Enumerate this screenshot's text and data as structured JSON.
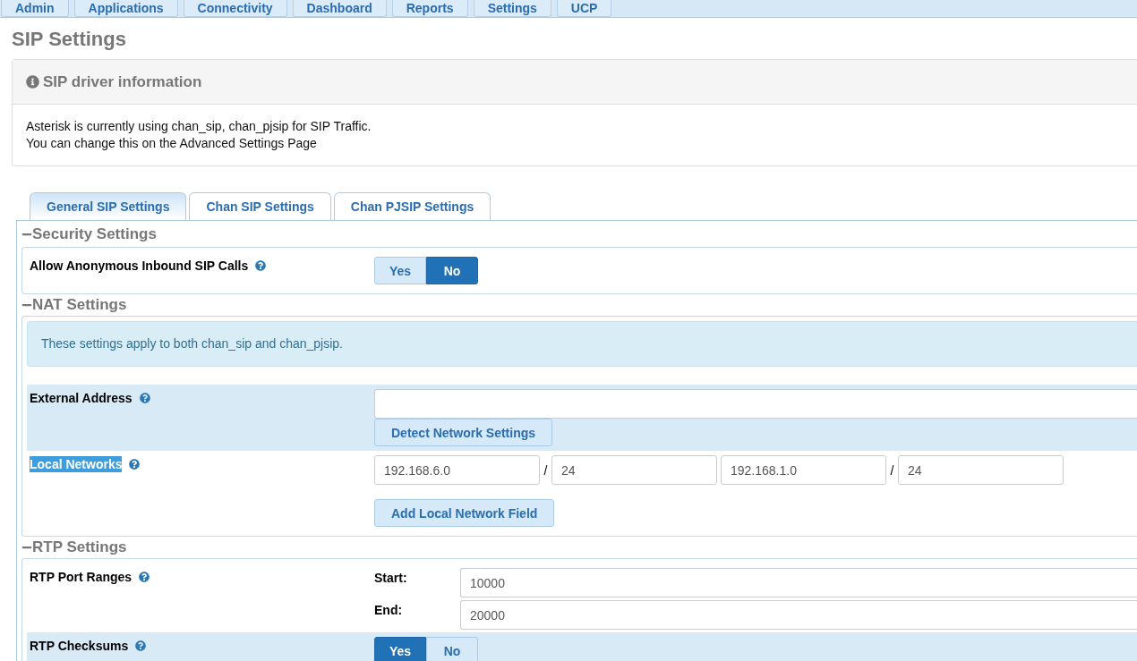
{
  "nav": [
    "Admin",
    "Applications",
    "Connectivity",
    "Dashboard",
    "Reports",
    "Settings",
    "UCP"
  ],
  "page_title": "SIP Settings",
  "info_panel": {
    "title": "SIP driver information",
    "lines": [
      "Asterisk is currently using chan_sip, chan_pjsip for SIP Traffic.",
      "You can change this on the Advanced Settings Page"
    ]
  },
  "tabs": [
    {
      "label": "General SIP Settings",
      "selected": true
    },
    {
      "label": "Chan SIP Settings",
      "selected": false
    },
    {
      "label": "Chan PJSIP Settings",
      "selected": false
    }
  ],
  "sections": [
    {
      "title": "Security Settings",
      "rows": [
        {
          "kind": "toggle",
          "label": "Allow Anonymous Inbound SIP Calls",
          "shaded": false,
          "label_selected": false,
          "options": [
            {
              "label": "Yes",
              "selected": false
            },
            {
              "label": "No",
              "selected": true
            }
          ]
        }
      ]
    },
    {
      "title": "NAT Settings",
      "notice": "These settings apply to both chan_sip and chan_pjsip.",
      "rows": [
        {
          "kind": "address",
          "label": "External Address",
          "shaded": true,
          "label_selected": false,
          "button": "Detect Network Settings"
        },
        {
          "kind": "networks",
          "label": "Local Networks",
          "shaded": false,
          "label_selected": true,
          "networks": [
            {
              "address": "192.168.6.0",
              "separator": "/",
              "mask": "24"
            },
            {
              "address": "192.168.1.0",
              "separator": "/",
              "mask": "24"
            }
          ],
          "button": "Add Local Network Field"
        }
      ]
    },
    {
      "title": "RTP Settings",
      "rows": [
        {
          "kind": "range",
          "label": "RTP Port Ranges",
          "shaded": false,
          "label_selected": false,
          "fields": [
            {
              "label": "Start:",
              "value": "10000"
            },
            {
              "label": "End:",
              "value": "20000"
            }
          ]
        },
        {
          "kind": "toggle",
          "label": "RTP Checksums",
          "shaded": true,
          "label_selected": false,
          "options": [
            {
              "label": "Yes",
              "selected": true
            },
            {
              "label": "No",
              "selected": false
            }
          ]
        }
      ]
    }
  ]
}
